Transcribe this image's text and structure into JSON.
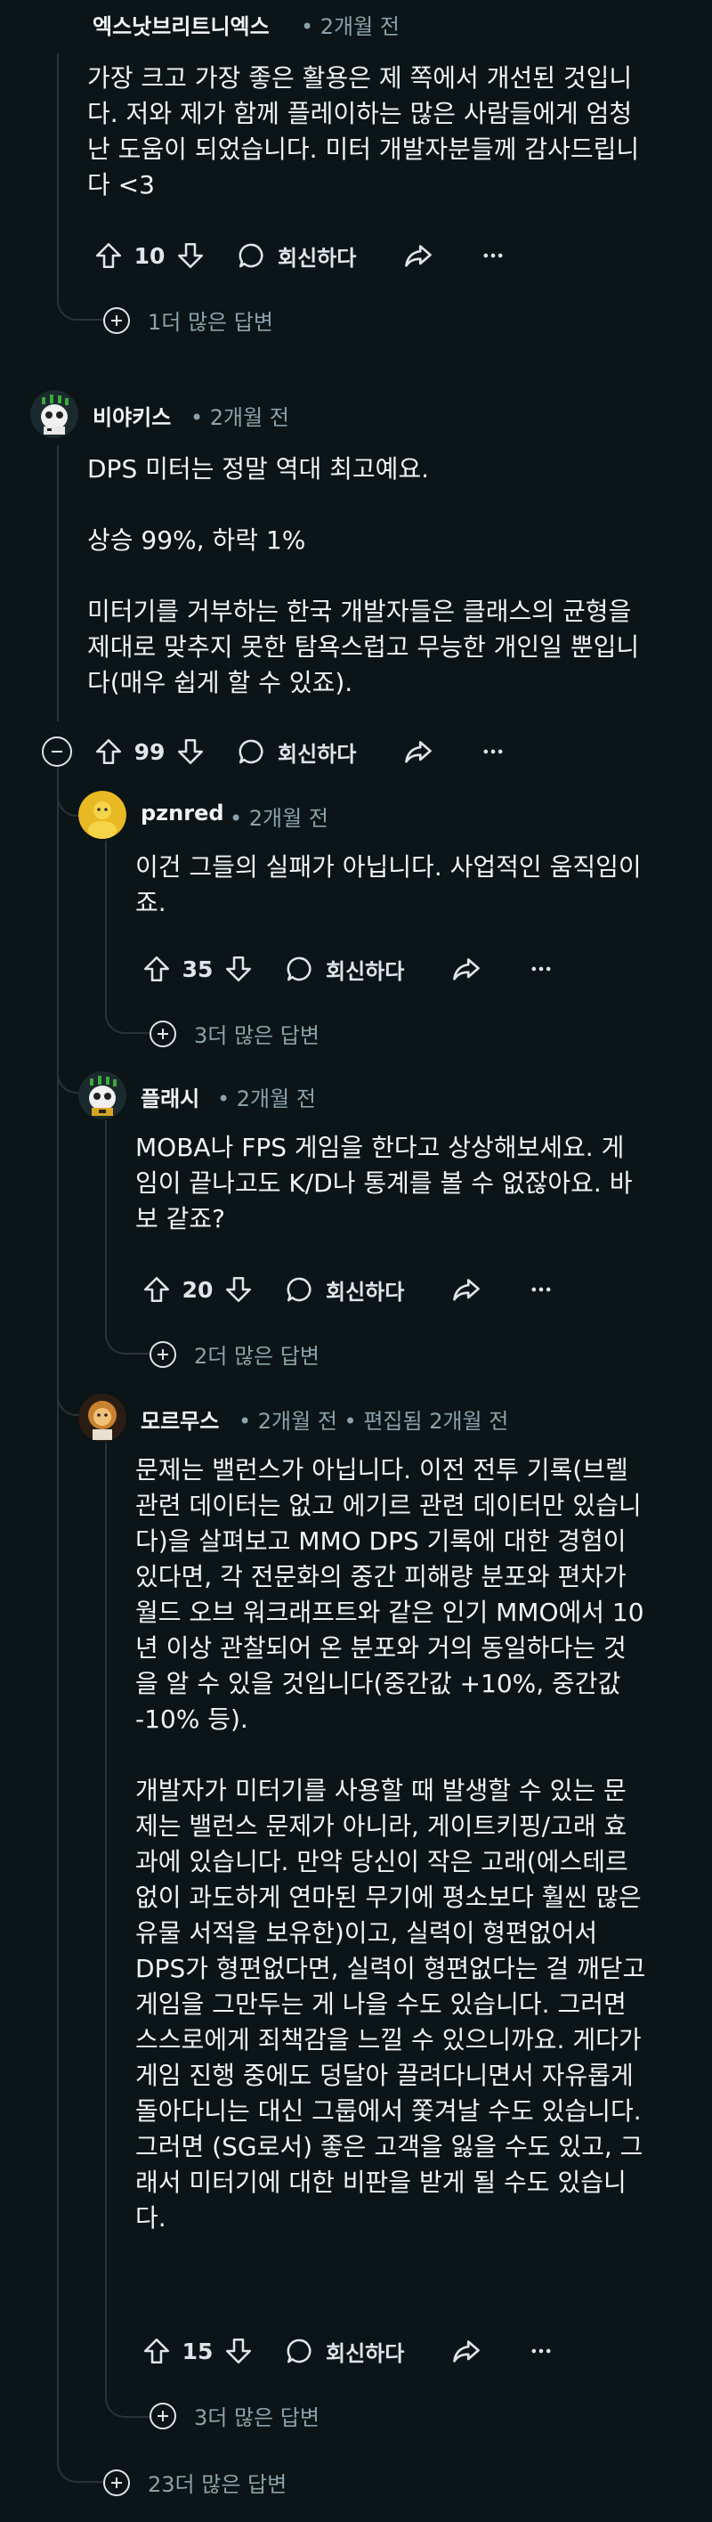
{
  "comments": {
    "c1": {
      "author": "엑스낫브리트니엑스",
      "time": "• 2개월 전",
      "body": "가장 크고 가장 좋은 활용은 제 쪽에서 개선된 것입니\n다. 저와 제가 함께 플레이하는 많은 사람들에게 엄청\n난 도움이 되었습니다. 미터 개발자분들께 감사드립니\n다 <3",
      "votes": "10",
      "reply_label": "회신하다",
      "more_replies": "1더 많은 답변"
    },
    "c2": {
      "author": "비야키스",
      "time": "• 2개월 전",
      "body": "DPS 미터는 정말 역대 최고예요.\n\n상승 99%, 하락 1%\n\n미터기를 거부하는 한국 개발자들은 클래스의 균형을\n제대로 맞추지 못한 탐욕스럽고 무능한 개인일 뿐입니\n다(매우 쉽게 할 수 있죠).",
      "votes": "99",
      "reply_label": "회신하다"
    },
    "c3": {
      "author": "pznred",
      "time": "• 2개월 전",
      "body": "이건 그들의 실패가 아닙니다. 사업적인 움직임이\n죠.",
      "votes": "35",
      "reply_label": "회신하다",
      "more_replies": "3더 많은 답변"
    },
    "c4": {
      "author": "플래시",
      "time": "• 2개월 전",
      "body": "MOBA나 FPS 게임을 한다고 상상해보세요. 게\n임이 끝나고도 K/D나 통계를 볼 수 없잖아요. 바\n보 같죠?",
      "votes": "20",
      "reply_label": "회신하다",
      "more_replies": "2더 많은 답변"
    },
    "c5": {
      "author": "모르무스",
      "time": "• 2개월 전 • 편집됨 2개월 전",
      "body": "문제는 밸런스가 아닙니다. 이전 전투 기록(브렐\n관련 데이터는 없고 에기르 관련 데이터만 있습니\n다)을 살펴보고 MMO DPS 기록에 대한 경험이\n있다면, 각 전문화의 중간 피해량 분포와 편차가\n월드 오브 워크래프트와 같은 인기 MMO에서 10\n년 이상 관찰되어 온 분포와 거의 동일하다는 것\n을 알 수 있을 것입니다(중간값 +10%, 중간값\n-10% 등).\n\n개발자가 미터기를 사용할 때 발생할 수 있는 문\n제는 밸런스 문제가 아니라, 게이트키핑/고래 효\n과에 있습니다. 만약 당신이 작은 고래(에스테르\n없이 과도하게 연마된 무기에 평소보다 훨씬 많은\n유물 서적을 보유한)이고, 실력이 형편없어서\nDPS가 형편없다면, 실력이 형편없다는 걸 깨닫고\n게임을 그만두는 게 나을 수도 있습니다. 그러면\n스스로에게 죄책감을 느낄 수 있으니까요. 게다가\n게임 진행 중에도 덩달아 끌려다니면서 자유롭게\n돌아다니는 대신 그룹에서 쫓겨날 수도 있습니다.\n그러면 (SG로서) 좋은 고객을 잃을 수도 있고, 그\n래서 미터기에 대한 비판을 받게 될 수도 있습니\n다.",
      "votes": "15",
      "reply_label": "회신하다",
      "more_replies": "3더 많은 답변"
    }
  },
  "root_more_replies": "23더 많은 답변",
  "colors": {
    "background": "#0b1416",
    "text": "#f2f4f5",
    "meta": "#8ba2ad",
    "thread_line": "#2a3236"
  }
}
